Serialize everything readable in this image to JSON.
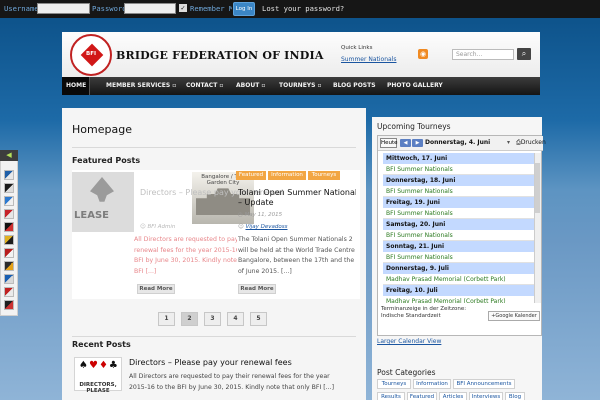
{
  "topbar": {
    "username_label": "Username",
    "password_label": "Password",
    "remember_label": "Remember Me",
    "login_button": "Log In",
    "lost_password": "Lost your password?"
  },
  "header": {
    "logo_text": "BFI",
    "site_title": "BRIDGE FEDERATION OF INDIA",
    "quick_links_title": "Quick Links",
    "quick_link": "Summer Nationals",
    "search_placeholder": "Search..."
  },
  "nav": [
    "HOME",
    "MEMBER SERVICES ▫",
    "CONTACT ▫",
    "ABOUT ▫",
    "TOURNEYS ▫",
    "BLOG POSTS",
    "PHOTO GALLERY"
  ],
  "main": {
    "page_title": "Homepage",
    "featured_title": "Featured Posts",
    "ghost_title": "Directors – Please pay your renewal",
    "img1_text": "LEASE",
    "img2_caption": "Bangalore / The Garden City",
    "tags": [
      "Featured",
      "Information",
      "Tourneys"
    ],
    "post1": {
      "author": "BFI Admin",
      "excerpt": [
        "All Directors are requested to pay their",
        "renewal fees for the year 2015-16 to the",
        "BFI by June 30, 2015. Kindly note that only",
        "BFI [...]"
      ],
      "read_more": "Read More"
    },
    "post2": {
      "title": [
        "Tolani Open Summer Nationals 2",
        "– Update"
      ],
      "date": "May 11, 2015",
      "author": "Vijay Devadoss",
      "excerpt": [
        "The Tolani Open Summer Nationals 2",
        "will be held at the World Trade Centre",
        "Bangalore, between the 17th and the",
        "of June 2015. [...]"
      ],
      "read_more": "Read More"
    },
    "pagination": [
      "1",
      "2",
      "3",
      "4",
      "5"
    ],
    "recent_title": "Recent Posts",
    "recent": {
      "thumb_word": "DIRECTORS, PLEASE",
      "title": "Directors – Please pay your renewal fees",
      "excerpt": [
        "All Directors are requested to pay their renewal fees for the year",
        "2015-16 to the BFI by June 30, 2015. Kindly note that only BFI [...]"
      ]
    }
  },
  "sidebar": {
    "tourneys_title": "Upcoming Tourneys",
    "calendar": {
      "today": "Heute",
      "prev": "◀",
      "next": "▶",
      "date": "Donnerstag, 4. Juni",
      "dropdown": "▾",
      "print": "Drucken",
      "rows": [
        {
          "type": "date",
          "text": "Mittwoch, 17. Juni"
        },
        {
          "type": "evt",
          "text": "BFI Summer Nationals"
        },
        {
          "type": "date",
          "text": "Donnerstag, 18. Juni"
        },
        {
          "type": "evt",
          "text": "BFI Summer Nationals"
        },
        {
          "type": "date",
          "text": "Freitag, 19. Juni"
        },
        {
          "type": "evt",
          "text": "BFI Summer Nationals"
        },
        {
          "type": "date",
          "text": "Samstag, 20. Juni"
        },
        {
          "type": "evt",
          "text": "BFI Summer Nationals"
        },
        {
          "type": "date",
          "text": "Sonntag, 21. Juni"
        },
        {
          "type": "evt",
          "text": "BFI Summer Nationals"
        },
        {
          "type": "date",
          "text": "Donnerstag, 9. Juli"
        },
        {
          "type": "evt",
          "text": "Madhav Prasad Memorial (Corbett Park)"
        },
        {
          "type": "date",
          "text": "Freitag, 10. Juli"
        },
        {
          "type": "evt",
          "text": "Madhav Prasad Memorial (Corbett Park)"
        }
      ],
      "footer": [
        "Terminanzeige in der Zeitzone:",
        "Indische Standardzeit"
      ],
      "gcal_button": "Google Kalender"
    },
    "larger_link": "Larger Calendar View",
    "categories_title": "Post Categories",
    "categories_row1": [
      "Tourneys",
      "Information",
      "BFI Announcements"
    ],
    "categories_row2": [
      "Results",
      "Featured",
      "Articles",
      "Interviews",
      "Blog"
    ]
  },
  "colors": {
    "accent_orange": "#f2a643",
    "link_blue": "#1a55a0",
    "calendar_event_green": "#2b7a1f",
    "calendar_date_bg": "#c3d9ff"
  }
}
